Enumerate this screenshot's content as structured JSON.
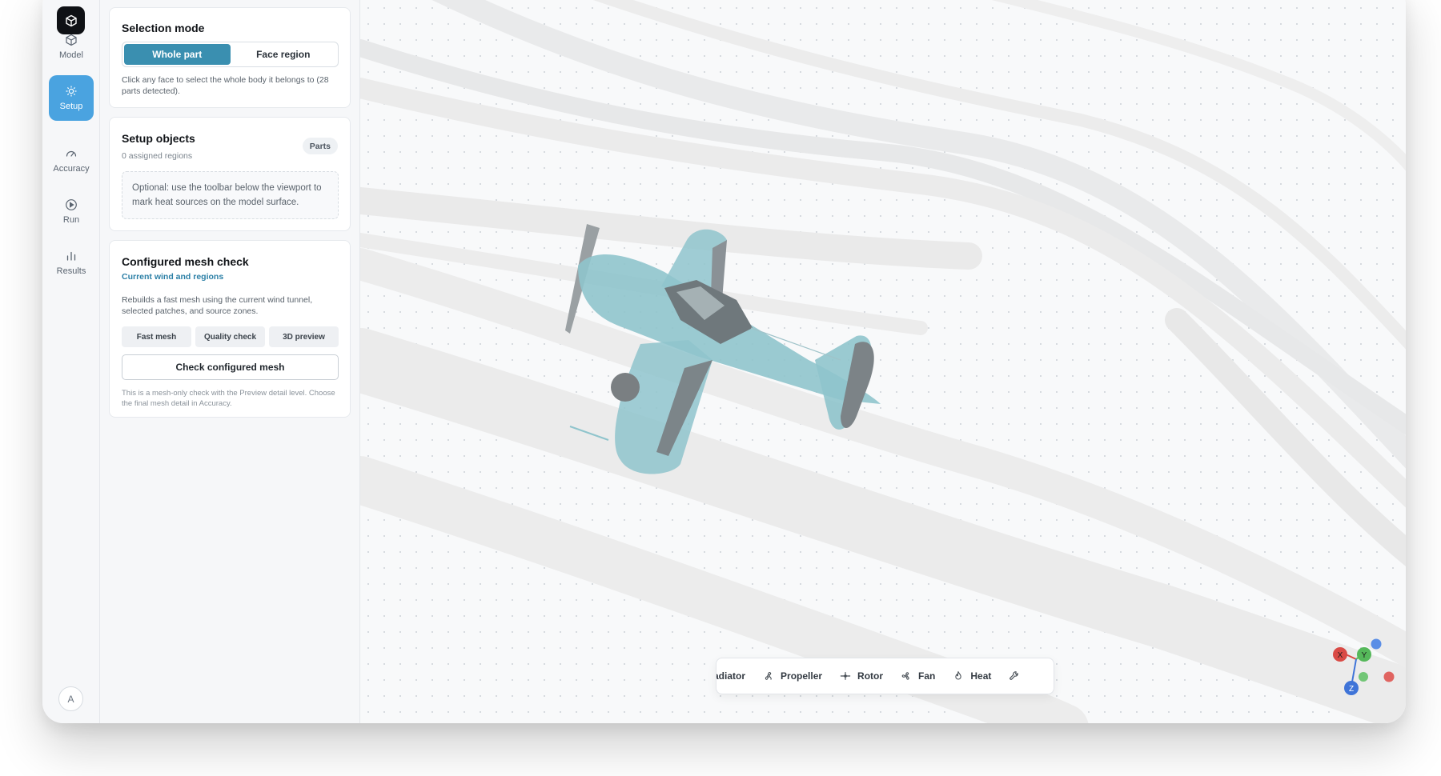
{
  "rail": {
    "items": [
      {
        "label": "Model"
      },
      {
        "label": "Setup"
      },
      {
        "label": "Accuracy"
      },
      {
        "label": "Run"
      },
      {
        "label": "Results"
      }
    ],
    "avatar": "A"
  },
  "selection": {
    "title": "Selection mode",
    "options": [
      "Whole part",
      "Face region"
    ],
    "selected": "Whole part",
    "hint": "Click any face to select the whole body it belongs to (28 parts detected)."
  },
  "setup_objects": {
    "title": "Setup objects",
    "subtitle": "0 assigned regions",
    "badge": "Parts",
    "note": "Optional: use the toolbar below the viewport to mark heat sources on the model surface."
  },
  "mesh_check": {
    "title": "Configured mesh check",
    "subtitle": "Current wind and regions",
    "description": "Rebuilds a fast mesh using the current wind tunnel, selected patches, and source zones.",
    "chips": [
      "Fast mesh",
      "Quality check",
      "3D preview"
    ],
    "button": "Check configured mesh",
    "footnote": "This is a mesh-only check with the Preview detail level. Choose the final mesh detail in Accuracy."
  },
  "toolbar": {
    "items": [
      "adiator",
      "Propeller",
      "Rotor",
      "Fan",
      "Heat"
    ]
  },
  "axes": {
    "x": "X",
    "y": "Y",
    "z": "Z"
  },
  "colors": {
    "accent": "#4aa3e0",
    "segment_on": "#3a8fb0",
    "subtitle_link": "#2b7fa6",
    "model": "#8fc4cc",
    "axis_x": "#d94a45",
    "axis_y": "#55b85a",
    "axis_z": "#3f74d8"
  }
}
